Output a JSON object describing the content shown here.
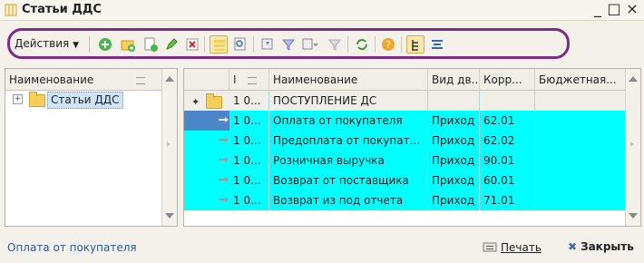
{
  "window": {
    "title": "Статьи ДДС",
    "minimize_glyph": "_",
    "maximize_glyph": "□",
    "close_glyph": "×"
  },
  "toolbar": {
    "actions_label": "Действия",
    "buttons": [
      "add-icon",
      "add-folder-icon",
      "copy-icon",
      "edit-icon",
      "delete-icon",
      "hierarchy-list-icon",
      "search-icon",
      "filter-icon",
      "filter-dropdown-icon",
      "clear-filter-icon",
      "refresh-icon",
      "help-icon",
      "tree-view-icon",
      "list-view-icon"
    ],
    "highlight_color": "#7b2c86"
  },
  "tree": {
    "column_header": "Наименование",
    "root_label": "Статьи ДДС"
  },
  "grid": {
    "columns": [
      "",
      "Наименование",
      "Вид дв...",
      "Корр...",
      "Бюджетная..."
    ],
    "rows": [
      {
        "code": "1 0...",
        "name": "ПОСТУПЛЕНИЕ ДС",
        "kind": "",
        "corr": "",
        "budget": "",
        "group": true,
        "selected": false
      },
      {
        "code": "1 0...",
        "name": "Оплата от покупателя",
        "kind": "Приход",
        "corr": "62.01",
        "budget": "",
        "group": false,
        "selected": true
      },
      {
        "code": "1 0...",
        "name": "Предоплата от покупат...",
        "kind": "Приход",
        "corr": "62.02",
        "budget": "",
        "group": false,
        "selected": false
      },
      {
        "code": "1 0...",
        "name": "Розничная выручка",
        "kind": "Приход",
        "corr": "90.01",
        "budget": "",
        "group": false,
        "selected": false
      },
      {
        "code": "1 0...",
        "name": "Возврат от поставщика",
        "kind": "Приход",
        "corr": "60.01",
        "budget": "",
        "group": false,
        "selected": false
      },
      {
        "code": "1 0...",
        "name": "Возврат из под отчета",
        "kind": "Приход",
        "corr": "71.01",
        "budget": "",
        "group": false,
        "selected": false
      }
    ],
    "row_color": "#00ffff",
    "selected_color": "#4a86c8"
  },
  "status": {
    "current_item": "Оплата от покупателя",
    "print_label": "Печать",
    "close_label": "Закрыть"
  }
}
